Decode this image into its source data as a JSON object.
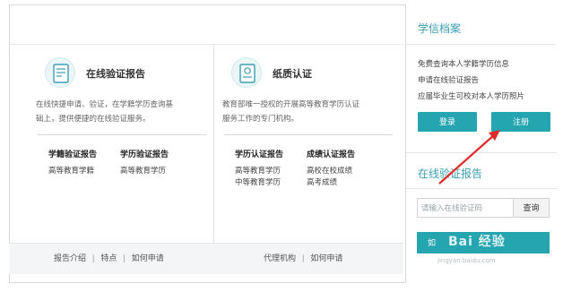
{
  "cards": [
    {
      "icon": "document-check-icon",
      "title": "在线验证报告",
      "desc_line1": "在线快捷申请、验证，在学籍学历查询基",
      "desc_line2": "础上，提供便捷的在线验证服务。",
      "col1": {
        "head": "学籍验证报告",
        "item": "高等教育学籍"
      },
      "col2": {
        "head": "学历验证报告",
        "item": "高等教育学历"
      },
      "links": [
        "报告介绍",
        "特点",
        "如何申请"
      ]
    },
    {
      "icon": "paper-certificate-icon",
      "title": "纸质认证",
      "desc_line1": "教育部唯一授权的开展高等教育学历认证",
      "desc_line2": "服务工作的专门机构。",
      "col1": {
        "head": "学历认证报告",
        "items": [
          "高等教育学历",
          "中等教育学历"
        ]
      },
      "col2": {
        "head": "成绩认证报告",
        "items": [
          "高校在校成绩",
          "高考成绩"
        ]
      },
      "links": [
        "代理机构",
        "如何申请"
      ]
    }
  ],
  "archive": {
    "title": "学信档案",
    "lines": [
      "免费查询本人学籍学历信息",
      "申请在线验证报告",
      "应届毕业生可校对本人学历照片"
    ],
    "login_label": "登录",
    "register_label": "注册"
  },
  "verify": {
    "title": "在线验证报告",
    "placeholder": "请输入在线验证码",
    "query_label": "查询",
    "bar_label": "如"
  },
  "watermark": {
    "text": "Bai 经验",
    "sub": "jingyan.baidu.com"
  },
  "colors": {
    "teal": "#24a5b0",
    "title_teal": "#3a9db3",
    "arrow": "#e02b2b"
  }
}
